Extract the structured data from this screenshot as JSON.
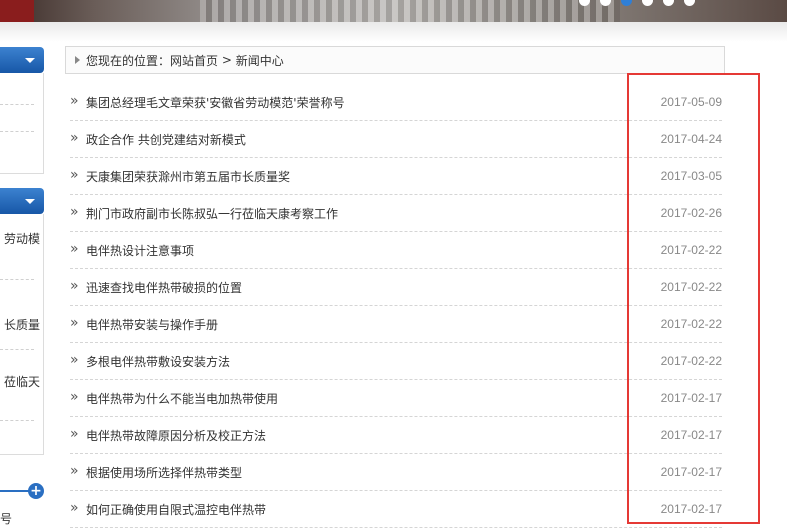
{
  "breadcrumb": {
    "prefix": "您现在的位置：",
    "home": "网站首页",
    "separator": " > ",
    "current": "新闻中心"
  },
  "sidebar": {
    "snippets": [
      "劳动模",
      "长质量",
      "莅临天",
      "号"
    ]
  },
  "news": [
    {
      "title": "集团总经理毛文章荣获'安徽省劳动模范'荣誉称号",
      "date": "2017-05-09"
    },
    {
      "title": "政企合作 共创党建结对新模式",
      "date": "2017-04-24"
    },
    {
      "title": "天康集团荣获滁州市第五届市长质量奖",
      "date": "2017-03-05"
    },
    {
      "title": "荆门市政府副市长陈叔弘一行莅临天康考察工作",
      "date": "2017-02-26"
    },
    {
      "title": "电伴热设计注意事项",
      "date": "2017-02-22"
    },
    {
      "title": "迅速查找电伴热带破损的位置",
      "date": "2017-02-22"
    },
    {
      "title": "电伴热带安装与操作手册",
      "date": "2017-02-22"
    },
    {
      "title": "多根电伴热带敷设安装方法",
      "date": "2017-02-22"
    },
    {
      "title": "电伴热带为什么不能当电加热带使用",
      "date": "2017-02-17"
    },
    {
      "title": "电伴热带故障原因分析及校正方法",
      "date": "2017-02-17"
    },
    {
      "title": "根据使用场所选择伴热带类型",
      "date": "2017-02-17"
    },
    {
      "title": "如何正确使用自限式温控电伴热带",
      "date": "2017-02-17"
    }
  ],
  "colors": {
    "accent": "#1757a7",
    "highlight": "#e53935",
    "slider_active": "#2f7fd6"
  }
}
